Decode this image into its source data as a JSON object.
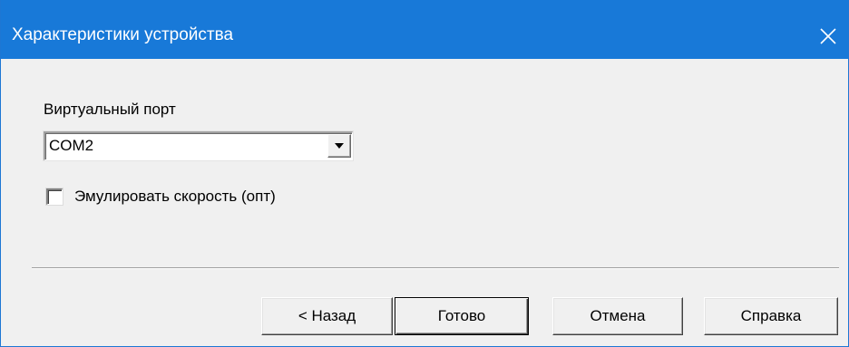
{
  "window": {
    "title": "Характеристики устройства",
    "close_icon": "close-icon",
    "titlebar_color": "#1879d8"
  },
  "form": {
    "port_label": "Виртуальный порт",
    "port_value": "COM2",
    "dropdown_icon": "triangle-down-icon",
    "emulate_speed_label": "Эмулировать скорость (опт)",
    "emulate_speed_checked": false
  },
  "buttons": {
    "back": "< Назад",
    "finish": "Готово",
    "cancel": "Отмена",
    "help": "Справка"
  }
}
